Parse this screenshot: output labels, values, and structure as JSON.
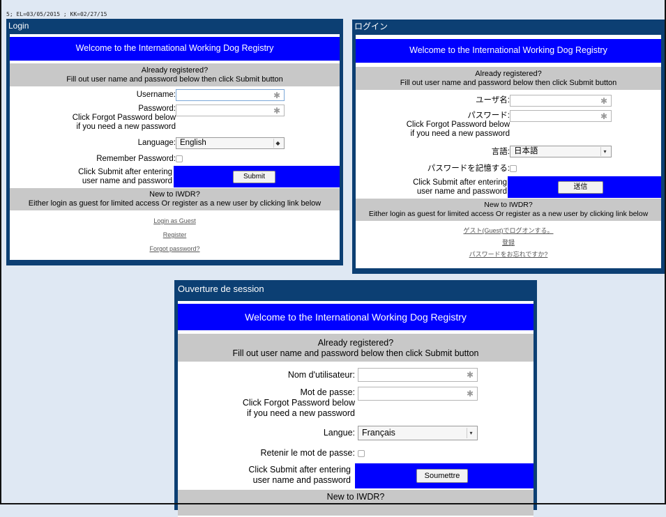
{
  "build_info": "5; EL=03/05/2015 ; KK=02/27/15",
  "en": {
    "title": "Login",
    "welcome": "Welcome to the International Working Dog Registry",
    "already_line1": "Already registered?",
    "already_line2": "Fill out user name and password below then click Submit button",
    "username_label": "Username:",
    "password_label": "Password:",
    "password_hint1": "Click Forgot Password below",
    "password_hint2": "if you need a new password",
    "language_label": "Language:",
    "language_value": "English",
    "remember_label": "Remember Password:",
    "submit_hint1": "Click Submit after entering",
    "submit_hint2": "user name and password",
    "submit_button": "Submit",
    "new_line1": "New to IWDR?",
    "new_line2": "Either login as guest for limited access Or register as a new user by clicking link below",
    "guest_link": "Login as Guest",
    "register_link": "Register",
    "forgot_link": "Forgot password?"
  },
  "ja": {
    "title": "ログイン",
    "welcome": "Welcome to the International Working Dog Registry",
    "already_line1": "Already registered?",
    "already_line2": "Fill out user name and password below then click Submit button",
    "username_label": "ユーザ名:",
    "password_label": "パスワード:",
    "password_hint1": "Click Forgot Password below",
    "password_hint2": "if you need a new password",
    "language_label": "言語:",
    "language_value": "日本語",
    "remember_label": "パスワードを記憶する:",
    "submit_hint1": "Click Submit after entering",
    "submit_hint2": "user name and password",
    "submit_button": "送信",
    "new_line1": "New to IWDR?",
    "new_line2": "Either login as guest for limited access Or register as a new user by clicking link below",
    "guest_link": "ゲスト(Guest)でログオンする。",
    "register_link": "登録",
    "forgot_link": "パスワードをお忘れですか?"
  },
  "fr": {
    "title": "Ouverture de session",
    "welcome": "Welcome to the International Working Dog Registry",
    "already_line1": "Already registered?",
    "already_line2": "Fill out user name and password below then click Submit button",
    "username_label": "Nom d'utilisateur:",
    "password_label": "Mot de passe:",
    "password_hint1": "Click Forgot Password below",
    "password_hint2": "if you need a new password",
    "language_label": "Langue:",
    "language_value": "Français",
    "remember_label": "Retenir le mot de passe:",
    "submit_hint1": "Click Submit after entering",
    "submit_hint2": "user name and password",
    "submit_button": "Soumettre",
    "new_line1": "New to IWDR?"
  },
  "colors": {
    "panel": "#0c3f73",
    "welcome_bg": "#0000ff",
    "section_gray": "#c8c8c8",
    "page_bg": "#dfe8f3"
  },
  "icons": {
    "required": "asterisk-icon",
    "dropdown": "chevron-updown-icon"
  }
}
